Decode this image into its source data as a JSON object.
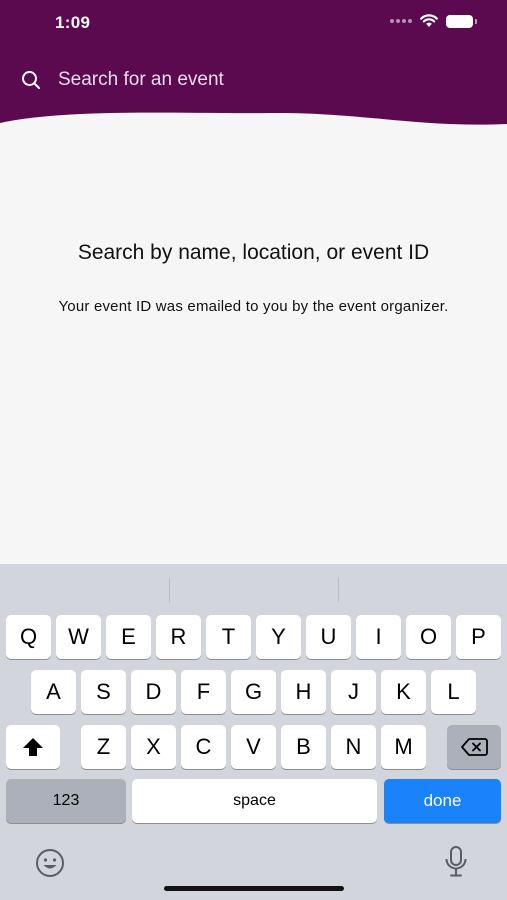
{
  "status_bar": {
    "time": "1:09"
  },
  "search": {
    "placeholder": "Search for an event",
    "value": ""
  },
  "empty_state": {
    "title": "Search by name, location, or event ID",
    "subtitle": "Your event ID was emailed to you by the event organizer."
  },
  "keyboard": {
    "row1": [
      "Q",
      "W",
      "E",
      "R",
      "T",
      "Y",
      "U",
      "I",
      "O",
      "P"
    ],
    "row2": [
      "A",
      "S",
      "D",
      "F",
      "G",
      "H",
      "J",
      "K",
      "L"
    ],
    "row3": [
      "Z",
      "X",
      "C",
      "V",
      "B",
      "N",
      "M"
    ],
    "numbers_label": "123",
    "space_label": "space",
    "done_label": "done"
  },
  "colors": {
    "header": "#5c0a4f",
    "done_key": "#1a82fb",
    "keyboard_bg": "#d2d5db"
  },
  "icons": [
    "search-icon",
    "wifi-icon",
    "battery-icon",
    "shift-icon",
    "backspace-icon",
    "emoji-icon",
    "microphone-icon"
  ]
}
